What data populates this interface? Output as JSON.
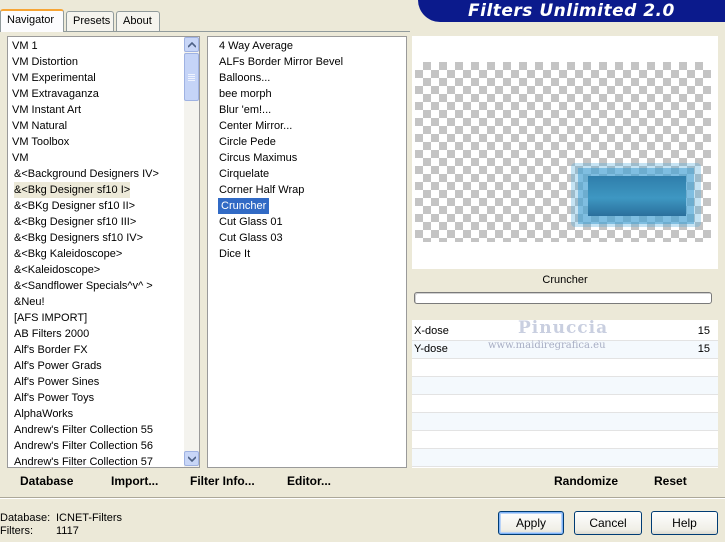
{
  "window_title": "Filters Unlimited 2.0",
  "tabs": [
    {
      "label": "Navigator",
      "active": true
    },
    {
      "label": "Presets",
      "active": false
    },
    {
      "label": "About",
      "active": false
    }
  ],
  "categories": [
    "VM 1",
    "VM Distortion",
    "VM Experimental",
    "VM Extravaganza",
    "VM Instant Art",
    "VM Natural",
    "VM Toolbox",
    "VM",
    "&<Background Designers IV>",
    "&<Bkg Designer sf10 I>",
    "&<BKg Designer sf10 II>",
    "&<Bkg Designer sf10 III>",
    "&<Bkg Designers sf10 IV>",
    "&<Bkg Kaleidoscope>",
    "&<Kaleidoscope>",
    "&<Sandflower Specials^v^ >",
    "&Neu!",
    "[AFS IMPORT]",
    "AB Filters 2000",
    "Alf's Border FX",
    "Alf's Power Grads",
    "Alf's Power Sines",
    "Alf's Power Toys",
    "AlphaWorks",
    "Andrew's Filter Collection 55",
    "Andrew's Filter Collection 56",
    "Andrew's Filter Collection 57"
  ],
  "selected_category": "&<Bkg Designer sf10 I>",
  "filters": [
    "4 Way Average",
    "ALFs Border Mirror Bevel",
    "Balloons...",
    "bee morph",
    "Blur 'em!...",
    "Center Mirror...",
    "Circle Pede",
    "Circus Maximus",
    "Cirquelate",
    "Corner Half Wrap",
    "Cruncher",
    "Cut Glass 01",
    "Cut Glass 03",
    "Dice It"
  ],
  "selected_filter": "Cruncher",
  "preview": {
    "filter_name": "Cruncher",
    "progress_percent": 0
  },
  "params": [
    {
      "label": "X-dose",
      "value": "15"
    },
    {
      "label": "Y-dose",
      "value": "15"
    }
  ],
  "watermark": {
    "name": "Pinuccia",
    "url": "www.maidiregrafica.eu"
  },
  "actions": {
    "database": "Database",
    "import": "Import...",
    "filter_info": "Filter Info...",
    "editor": "Editor...",
    "randomize": "Randomize",
    "reset": "Reset"
  },
  "status": {
    "database_label": "Database:",
    "database_value": "ICNET-Filters",
    "filters_label": "Filters:",
    "filters_value": "1117"
  },
  "buttons": {
    "apply": "Apply",
    "cancel": "Cancel",
    "help": "Help"
  },
  "colors": {
    "banner": "#0b1a8c",
    "selection": "#316ac5",
    "tab_accent": "#f7a535"
  }
}
